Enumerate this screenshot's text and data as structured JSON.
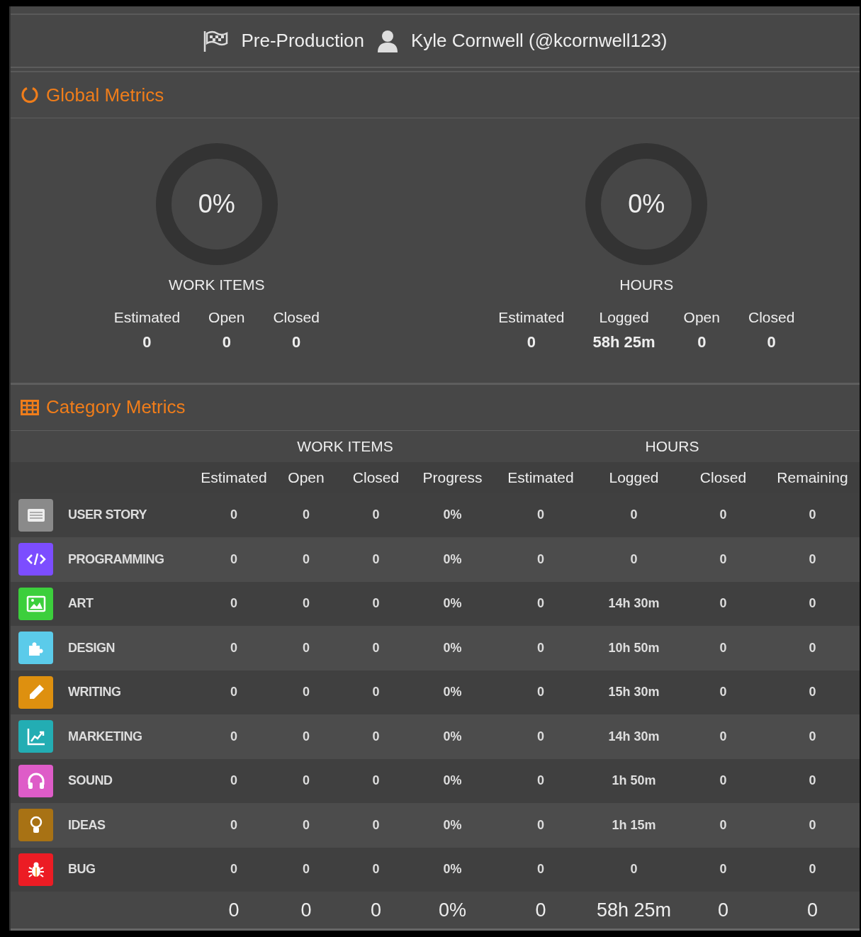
{
  "header": {
    "project": "Pre-Production",
    "user": "Kyle Cornwell (@kcornwell123)"
  },
  "global_metrics": {
    "title": "Global Metrics",
    "donuts": [
      {
        "value": "0%",
        "level": 0,
        "label": "WORK ITEMS",
        "stats": [
          {
            "label": "Estimated",
            "value": "0"
          },
          {
            "label": "Open",
            "value": "0"
          },
          {
            "label": "Closed",
            "value": "0"
          }
        ]
      },
      {
        "value": "0%",
        "level": 0,
        "label": "HOURS",
        "stats": [
          {
            "label": "Estimated",
            "value": "0"
          },
          {
            "label": "Logged",
            "value": "58h 25m"
          },
          {
            "label": "Open",
            "value": "0"
          },
          {
            "label": "Closed",
            "value": "0"
          }
        ]
      }
    ]
  },
  "category_metrics": {
    "title": "Category Metrics",
    "groups": [
      "WORK ITEMS",
      "HOURS"
    ],
    "columns": [
      "Estimated",
      "Open",
      "Closed",
      "Progress",
      "Estimated",
      "Logged",
      "Closed",
      "Remaining"
    ],
    "rows": [
      {
        "kind": "list",
        "color": "#8a8a8a",
        "name": "USER STORY",
        "cells": [
          "0",
          "0",
          "0",
          "0%",
          "0",
          "0",
          "0",
          "0"
        ]
      },
      {
        "kind": "code",
        "color": "#7c4dff",
        "name": "PROGRAMMING",
        "cells": [
          "0",
          "0",
          "0",
          "0%",
          "0",
          "0",
          "0",
          "0"
        ]
      },
      {
        "kind": "image",
        "color": "#3ccf3c",
        "name": "ART",
        "cells": [
          "0",
          "0",
          "0",
          "0%",
          "0",
          "14h 30m",
          "0",
          "0"
        ]
      },
      {
        "kind": "puzzle",
        "color": "#5bcbea",
        "name": "DESIGN",
        "cells": [
          "0",
          "0",
          "0",
          "0%",
          "0",
          "10h 50m",
          "0",
          "0"
        ]
      },
      {
        "kind": "pencil",
        "color": "#de900f",
        "name": "WRITING",
        "cells": [
          "0",
          "0",
          "0",
          "0%",
          "0",
          "15h 30m",
          "0",
          "0"
        ]
      },
      {
        "kind": "chart",
        "color": "#23adb3",
        "name": "MARKETING",
        "cells": [
          "0",
          "0",
          "0",
          "0%",
          "0",
          "14h 30m",
          "0",
          "0"
        ]
      },
      {
        "kind": "headphones",
        "color": "#de5cc8",
        "name": "SOUND",
        "cells": [
          "0",
          "0",
          "0",
          "0%",
          "0",
          "1h 50m",
          "0",
          "0"
        ]
      },
      {
        "kind": "bulb",
        "color": "#a87214",
        "name": "IDEAS",
        "cells": [
          "0",
          "0",
          "0",
          "0%",
          "0",
          "1h 15m",
          "0",
          "0"
        ]
      },
      {
        "kind": "bug",
        "color": "#ec1c24",
        "name": "BUG",
        "cells": [
          "0",
          "0",
          "0",
          "0%",
          "0",
          "0",
          "0",
          "0"
        ]
      }
    ],
    "totals": [
      "0",
      "0",
      "0",
      "0%",
      "0",
      "58h 25m",
      "0",
      "0"
    ]
  }
}
